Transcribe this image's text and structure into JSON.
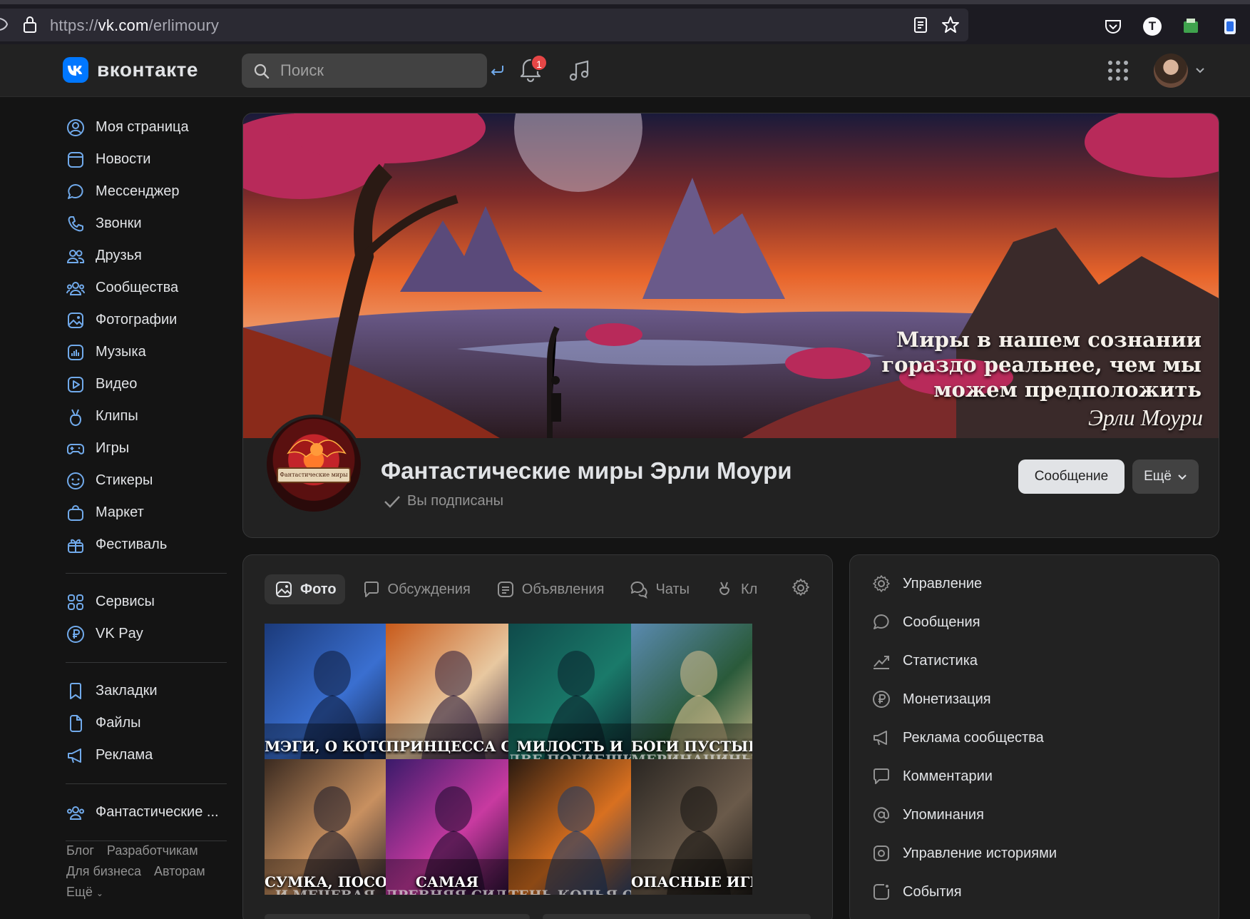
{
  "browser": {
    "url_prefix": "https://",
    "url_host": "vk.com",
    "url_path": "/erlimoury",
    "ext_t_letter": "T"
  },
  "header": {
    "logo_text": "вконтакте",
    "search_placeholder": "Поиск",
    "notification_count": "1"
  },
  "sidebar": {
    "main": [
      {
        "label": "Моя страница",
        "icon": "user-circle-icon"
      },
      {
        "label": "Новости",
        "icon": "news-icon"
      },
      {
        "label": "Мессенджер",
        "icon": "message-icon"
      },
      {
        "label": "Звонки",
        "icon": "phone-icon"
      },
      {
        "label": "Друзья",
        "icon": "friends-icon"
      },
      {
        "label": "Сообщества",
        "icon": "communities-icon"
      },
      {
        "label": "Фотографии",
        "icon": "photo-icon"
      },
      {
        "label": "Музыка",
        "icon": "music-icon"
      },
      {
        "label": "Видео",
        "icon": "video-icon"
      },
      {
        "label": "Клипы",
        "icon": "clips-icon"
      },
      {
        "label": "Игры",
        "icon": "gamepad-icon"
      },
      {
        "label": "Стикеры",
        "icon": "smile-icon"
      },
      {
        "label": "Маркет",
        "icon": "bag-icon"
      },
      {
        "label": "Фестиваль",
        "icon": "gift-icon"
      }
    ],
    "services": [
      {
        "label": "Сервисы",
        "icon": "services-icon"
      },
      {
        "label": "VK Pay",
        "icon": "ruble-icon"
      }
    ],
    "tools": [
      {
        "label": "Закладки",
        "icon": "bookmark-icon"
      },
      {
        "label": "Файлы",
        "icon": "file-icon"
      },
      {
        "label": "Реклама",
        "icon": "megaphone-icon"
      }
    ],
    "community": {
      "label": "Фантастические ...",
      "icon": "communities-icon"
    },
    "footer": {
      "blog": "Блог",
      "developers": "Разработчикам",
      "business": "Для бизнеса",
      "authors": "Авторам",
      "more": "Ещё"
    }
  },
  "community": {
    "cover_quote_lines": [
      "Миры в нашем сознании",
      "гораздо реальнее, чем мы",
      "можем предположить"
    ],
    "cover_signature": "Эрли Моури",
    "avatar_plate_text": "Фантастические миры · Эрли Моури",
    "name": "Фантастические миры Эрли Моури",
    "subscribed_label": "Вы подписаны",
    "message_button": "Сообщение",
    "more_button": "Ещё"
  },
  "tabs": [
    {
      "label": "Фото",
      "icon": "photo-icon",
      "active": true
    },
    {
      "label": "Обсуждения",
      "icon": "discussion-icon",
      "active": false
    },
    {
      "label": "Объявления",
      "icon": "announcement-icon",
      "active": false
    },
    {
      "label": "Чаты",
      "icon": "chats-icon",
      "active": false
    },
    {
      "label": "Кл",
      "icon": "clips-icon",
      "active": false
    }
  ],
  "photos": [
    {
      "caption": "МЭГИ, О КОТОРОЙ",
      "caption2": "",
      "palette": [
        "#1b3a7a",
        "#3a6fd0",
        "#0e1b3a"
      ]
    },
    {
      "caption": "ПРИНЦЕССА С",
      "caption2": "",
      "palette": [
        "#c85a1a",
        "#e8c8a0",
        "#2a1a3a"
      ]
    },
    {
      "caption": "МИЛОСТЬ И",
      "caption2": "ДВЕ ПОГИБШИ",
      "palette": [
        "#0f4a4a",
        "#1a7a6a",
        "#0a1f2a"
      ]
    },
    {
      "caption": "БОГИ ПУСТЫНЬ",
      "caption2": "МЕРИНАЧИНЫ",
      "palette": [
        "#5a8ab0",
        "#2a5a3a",
        "#d8c090"
      ]
    },
    {
      "caption": "СУМКА, ПОСОХ",
      "caption2": "И МЕЧЕВАЯ",
      "palette": [
        "#3a2a20",
        "#c89060",
        "#1a1a2a"
      ]
    },
    {
      "caption": "САМАЯ",
      "caption2": "ДРЕВНЯЯ СИЛА",
      "palette": [
        "#3a1a6a",
        "#c83aa0",
        "#1a0a2a"
      ]
    },
    {
      "caption": "",
      "caption2": "ТЕНЬ КОПЬЯ ОВО",
      "palette": [
        "#2a1a10",
        "#d87020",
        "#1a3a6a"
      ]
    },
    {
      "caption": "ОПАСНЫЕ ИГРЫ",
      "caption2": "",
      "palette": [
        "#2a2622",
        "#6a5a4a",
        "#141210"
      ]
    }
  ],
  "management": [
    {
      "label": "Управление",
      "icon": "gear-icon"
    },
    {
      "label": "Сообщения",
      "icon": "message-icon"
    },
    {
      "label": "Статистика",
      "icon": "chart-icon"
    },
    {
      "label": "Монетизация",
      "icon": "ruble-icon"
    },
    {
      "label": "Реклама сообщества",
      "icon": "megaphone-icon"
    },
    {
      "label": "Комментарии",
      "icon": "comment-icon"
    },
    {
      "label": "Упоминания",
      "icon": "at-icon"
    },
    {
      "label": "Управление историями",
      "icon": "stories-icon"
    },
    {
      "label": "События",
      "icon": "event-icon"
    }
  ],
  "colors": {
    "background": "#141414",
    "panel": "#222222",
    "accent": "#0077ff",
    "text": "#e1e3e6",
    "secondary_text": "#939393",
    "badge": "#e64646"
  }
}
